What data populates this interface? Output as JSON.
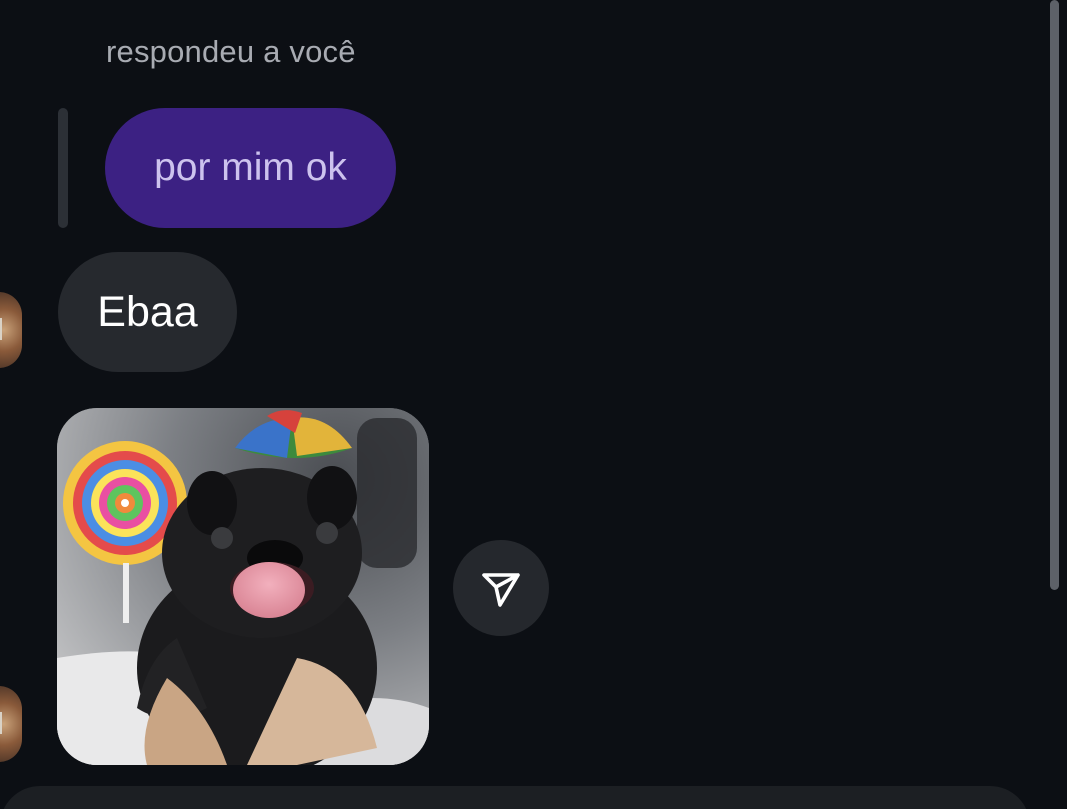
{
  "thread": {
    "reply_caption": "respondeu a você",
    "quoted_message": "por mim ok",
    "message_text": "Ebaa"
  },
  "sticker": {
    "description_icon": "pug-with-lollipop-sticker"
  },
  "actions": {
    "share_icon": "send-paper-plane-icon"
  },
  "colors": {
    "background": "#0c0f14",
    "own_bubble": "#3c2183",
    "other_bubble": "#26292e",
    "caption": "#a8abb2"
  }
}
